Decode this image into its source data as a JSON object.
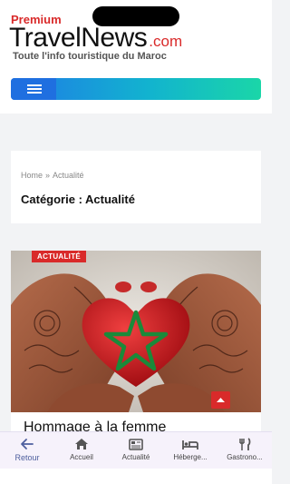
{
  "header": {
    "logo_premium": "Premium",
    "logo_name": "TravelNews",
    "logo_domain": ".com",
    "tagline": "Toute l'info touristique du Maroc"
  },
  "menu": {
    "icon": "hamburger-icon"
  },
  "breadcrumb": {
    "home": "Home",
    "separator": "»",
    "current": "Actualité"
  },
  "page_title": "Catégorie : Actualité",
  "article": {
    "category": "ACTUALITÉ",
    "title": "Hommage à la femme"
  },
  "bottom_nav": {
    "items": [
      {
        "label": "Retour",
        "icon": "arrow-back-icon",
        "active": true
      },
      {
        "label": "Accueil",
        "icon": "home-icon",
        "active": false
      },
      {
        "label": "Actualité",
        "icon": "newspaper-icon",
        "active": false
      },
      {
        "label": "Héberge...",
        "icon": "bed-icon",
        "active": false
      },
      {
        "label": "Gastrono...",
        "icon": "fork-knife-icon",
        "active": false
      }
    ]
  },
  "colors": {
    "brand_red": "#d92a2a",
    "nav_gradient_start": "#1f7be6",
    "nav_gradient_end": "#1ad6a8",
    "active_nav": "#4e5f9e"
  }
}
